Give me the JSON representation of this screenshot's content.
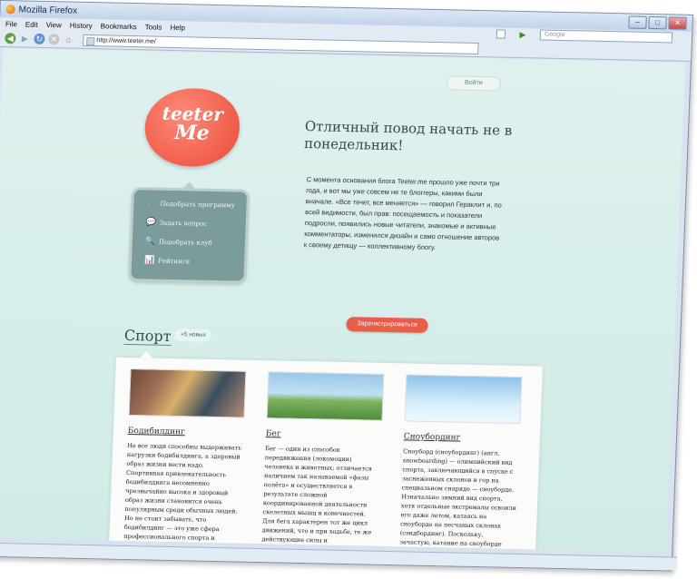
{
  "window": {
    "title": "Mozilla Firefox"
  },
  "menu": [
    "File",
    "Edit",
    "View",
    "History",
    "Bookmarks",
    "Tools",
    "Help"
  ],
  "toolbar": {
    "url": "http://www.teeter.me/",
    "search_placeholder": "Google"
  },
  "page": {
    "login": "Войти",
    "logo": {
      "line1": "teeter",
      "line2": "Me"
    },
    "headline": "Отличный повод начать не в понедельник!",
    "intro": "С момента основания блога Teeter.me прошло уже почти три года, и вот мы уже совсем не те блоггеры, какими были вначале. «Все течет, все меняется» — говорил Гераклит и, по всей видимости, был прав: посещаемость и показатели подросли, появились новые читатели, знакомые и активные комментаторы, изменился дизайн и само отношение авторов к своему детищу — коллективному блогу.",
    "side_menu": [
      {
        "icon": "bicycle-icon",
        "glyph": "🚲",
        "label": "Подобрать программу"
      },
      {
        "icon": "chat-bubble-icon",
        "glyph": "💬",
        "label": "Задать вопрос"
      },
      {
        "icon": "search-icon",
        "glyph": "🔍",
        "label": "Подобрать клуб"
      },
      {
        "icon": "chart-icon",
        "glyph": "📊",
        "label": "Рейтинги"
      }
    ],
    "register": "Зарегистрироваться",
    "section": {
      "title": "Спорт",
      "badge": "+5 новых"
    },
    "cards": [
      {
        "title": "Бодибилдинг",
        "text": "Не все люди способны выдерживать нагрузки бодибилдинга, а здоровый образ жизни вести надо. Спортивная привлекательность бодибилдинга несомненно чрезвычайно высока и здоровый образ жизни становится очень популярным среди обычных людей. Но не стоит забывать, что бодибилдинг — это уже сфера профессионального спорта и искусства в некотором роде, которое нужно далеко не всем."
      },
      {
        "title": "Бег",
        "text": "Бег — один из способов передвижения (локомоции) человека и животных; отличается наличием так называемой «фазы полёта» и осуществляется в результате сложной координированной деятельности скелетных мышц и конечностей. Для бега характерен тот же цикл движений, что и при ходьбе, те же действующие силы и функциональные группы мышц, фазы двойной опоры."
      },
      {
        "title": "Сноубординг",
        "text": "Сноуборд (сноубординг) (англ. snowboarding) — олимпийский вид спорта, заключающийся в спуске с заснеженных склонов и гор на специальном снаряде — сноуборде. Изначально зимний вид спорта, хотя отдельные экстремалы освоили его даже летом, катаясь на сноуборде на песчаных склонах (сэндбординг). Поскольку, зачастую, катание на сноуборде проходит на неподготовленных склонах и на"
      }
    ]
  },
  "status": "Done"
}
